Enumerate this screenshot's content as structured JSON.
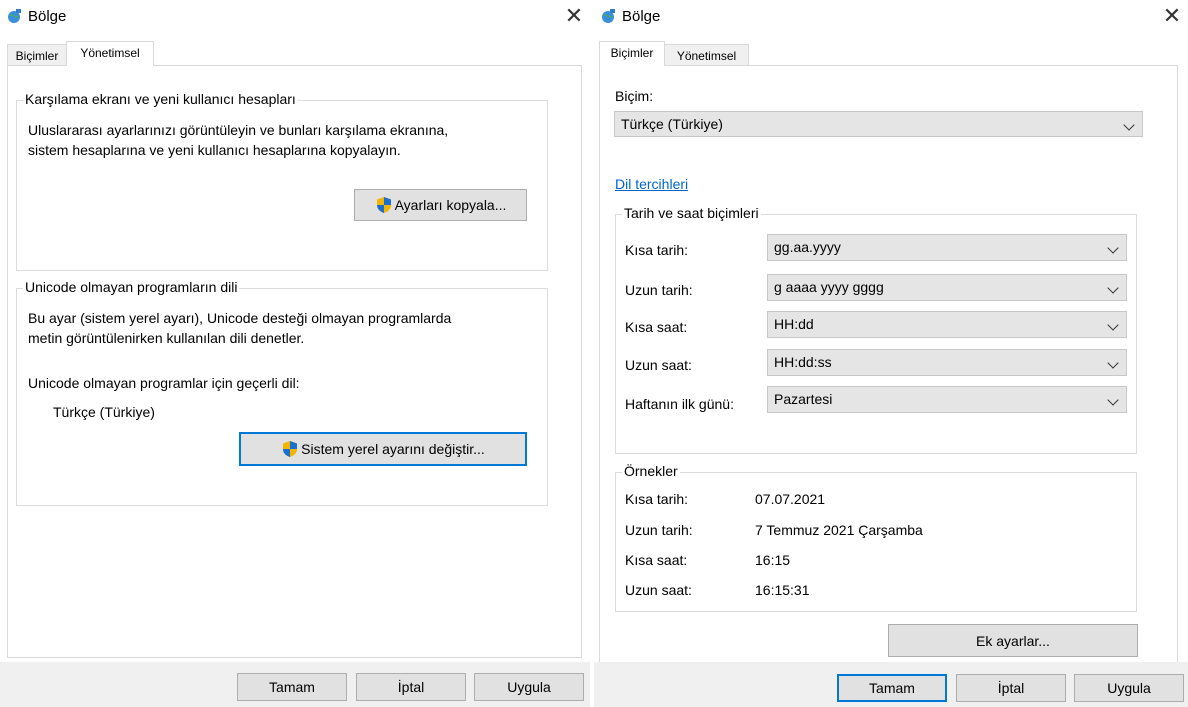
{
  "left_window": {
    "title": "Bölge",
    "close_symbol": "✕",
    "tabs": [
      "Biçimler",
      "Yönetimsel"
    ],
    "active_tab": "Yönetimsel",
    "welcome_group": {
      "title": "Karşılama ekranı ve yeni kullanıcı hesapları",
      "line1": "Uluslararası ayarlarınızı görüntüleyin ve bunları karşılama ekranına,",
      "line2": "sistem hesaplarına ve yeni kullanıcı hesaplarına kopyalayın.",
      "copy_button": "Ayarları kopyala..."
    },
    "unicode_group": {
      "title": "Unicode olmayan programların dili",
      "line1": "Bu ayar (sistem yerel ayarı), Unicode desteği olmayan programlarda",
      "line2": "metin görüntülenirken kullanılan dili denetler.",
      "current_label": "Unicode olmayan programlar için geçerli dil:",
      "current_value": "Türkçe (Türkiye)",
      "change_button": "Sistem yerel ayarını değiştir..."
    },
    "buttons": {
      "ok": "Tamam",
      "cancel": "İptal",
      "apply": "Uygula"
    }
  },
  "right_window": {
    "title": "Bölge",
    "close_symbol": "✕",
    "tabs": [
      "Biçimler",
      "Yönetimsel"
    ],
    "active_tab": "Biçimler",
    "format_label": "Biçim:",
    "format_value": "Türkçe (Türkiye)",
    "language_link": "Dil tercihleri",
    "date_time_group": {
      "title": "Tarih ve saat biçimleri",
      "rows": [
        {
          "label": "Kısa tarih:",
          "value": "gg.aa.yyyy"
        },
        {
          "label": "Uzun tarih:",
          "value": "g aaaa yyyy gggg"
        },
        {
          "label": "Kısa saat:",
          "value": "HH:dd"
        },
        {
          "label": "Uzun saat:",
          "value": "HH:dd:ss"
        },
        {
          "label": "Haftanın ilk günü:",
          "value": "Pazartesi"
        }
      ]
    },
    "examples_group": {
      "title": "Örnekler",
      "rows": [
        {
          "label": "Kısa tarih:",
          "value": "07.07.2021"
        },
        {
          "label": "Uzun tarih:",
          "value": "7 Temmuz 2021 Çarşamba"
        },
        {
          "label": "Kısa saat:",
          "value": "16:15"
        },
        {
          "label": "Uzun saat:",
          "value": "16:15:31"
        }
      ]
    },
    "additional_settings_button": "Ek ayarlar...",
    "buttons": {
      "ok": "Tamam",
      "cancel": "İptal",
      "apply": "Uygula"
    }
  },
  "colors": {
    "accent": "#0078d7",
    "link": "#0066cc",
    "footer": "#f0f0f0",
    "button": "#e1e1e1"
  }
}
